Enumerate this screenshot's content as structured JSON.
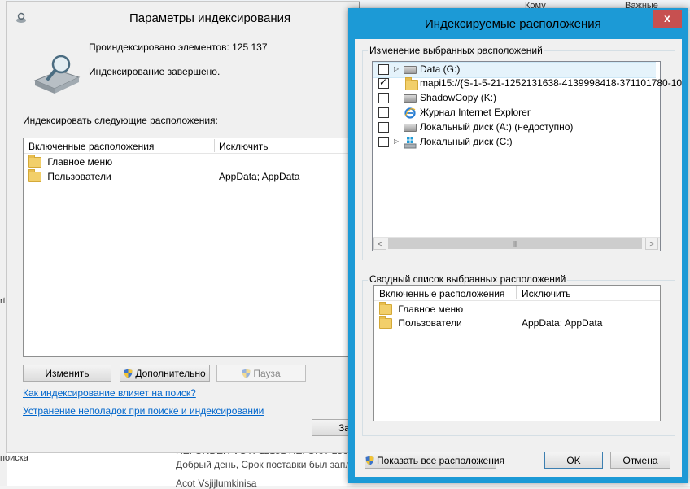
{
  "background": {
    "top_hint_1": "Кому",
    "top_hint_2": "Важные",
    "left_fragment_1": "rt",
    "left_fragment_2": "поиска",
    "mail_line_1": "RE: ORDER VOTF12152 RE: OrcT 2563520",
    "mail_line_2": "Добрый день,  Срок поставки был запла",
    "mail_line_3": "Acot Vsjijlumkinisa"
  },
  "main_window": {
    "title": "Параметры индексирования",
    "indexed_count_text": "Проиндексировано элементов: 125 137",
    "status_text": "Индексирование завершено.",
    "section_label": "Индексировать следующие расположения:",
    "columns": [
      "Включенные расположения",
      "Исключить"
    ],
    "rows": [
      {
        "name": "Главное меню",
        "exclude": ""
      },
      {
        "name": "Пользователи",
        "exclude": "AppData; AppData"
      }
    ],
    "buttons": {
      "modify": "Изменить",
      "advanced": "Дополнительно",
      "pause": "Пауза",
      "close_partial": "За"
    },
    "links": {
      "how_affects": "Как индексирование влияет на поиск?",
      "troubleshoot": "Устранение неполадок при поиске и индексировании"
    }
  },
  "dialog": {
    "title": "Индексируемые расположения",
    "close_glyph": "x",
    "change_group_label": "Изменение выбранных расположений",
    "tree": [
      {
        "label": "Data (G:)",
        "checked": false,
        "expandable": true,
        "icon": "drive-icon"
      },
      {
        "label": "mapi15://{S-1-5-21-1252131638-4139998418-371101780-10",
        "checked": true,
        "expandable": false,
        "icon": "folder-icon"
      },
      {
        "label": "ShadowCopy (K:)",
        "checked": false,
        "expandable": false,
        "icon": "drive-icon"
      },
      {
        "label": "Журнал Internet Explorer",
        "checked": false,
        "expandable": false,
        "icon": "ie-icon"
      },
      {
        "label": "Локальный диск (A:) (недоступно)",
        "checked": false,
        "expandable": false,
        "icon": "drive-icon"
      },
      {
        "label": "Локальный диск (C:)",
        "checked": false,
        "expandable": true,
        "icon": "windows-drive-icon"
      }
    ],
    "summary_group_label": "Сводный список выбранных расположений",
    "summary_columns": [
      "Включенные расположения",
      "Исключить"
    ],
    "summary_rows": [
      {
        "name": "Главное меню",
        "exclude": ""
      },
      {
        "name": "Пользователи",
        "exclude": "AppData; AppData"
      }
    ],
    "buttons": {
      "show_all": "Показать все расположения",
      "ok": "OK",
      "cancel": "Отмена"
    }
  }
}
